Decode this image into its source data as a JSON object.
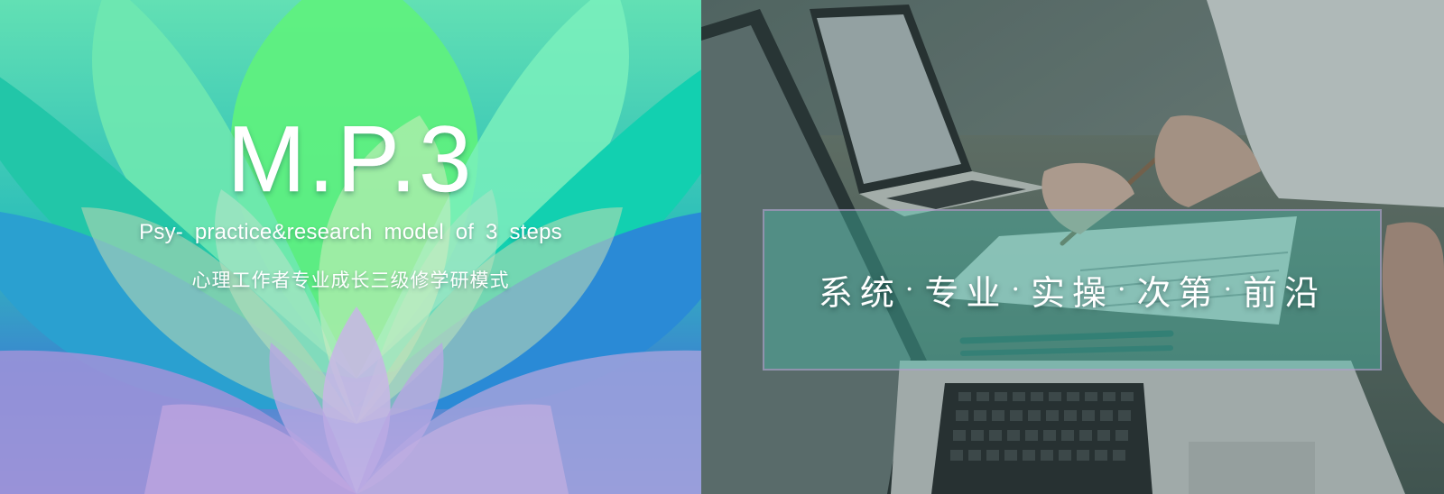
{
  "banner": {
    "left": {
      "title": "M.P.3",
      "subtitle_en": "Psy- practice&research  model  of  3 steps",
      "subtitle_cn": "心理工作者专业成长三级修学研模式"
    },
    "right": {
      "slogan_items": [
        "系统",
        "专业",
        "实操",
        "次第",
        "前沿"
      ],
      "separator": "·",
      "overlay_color": "#46c8b4"
    }
  }
}
